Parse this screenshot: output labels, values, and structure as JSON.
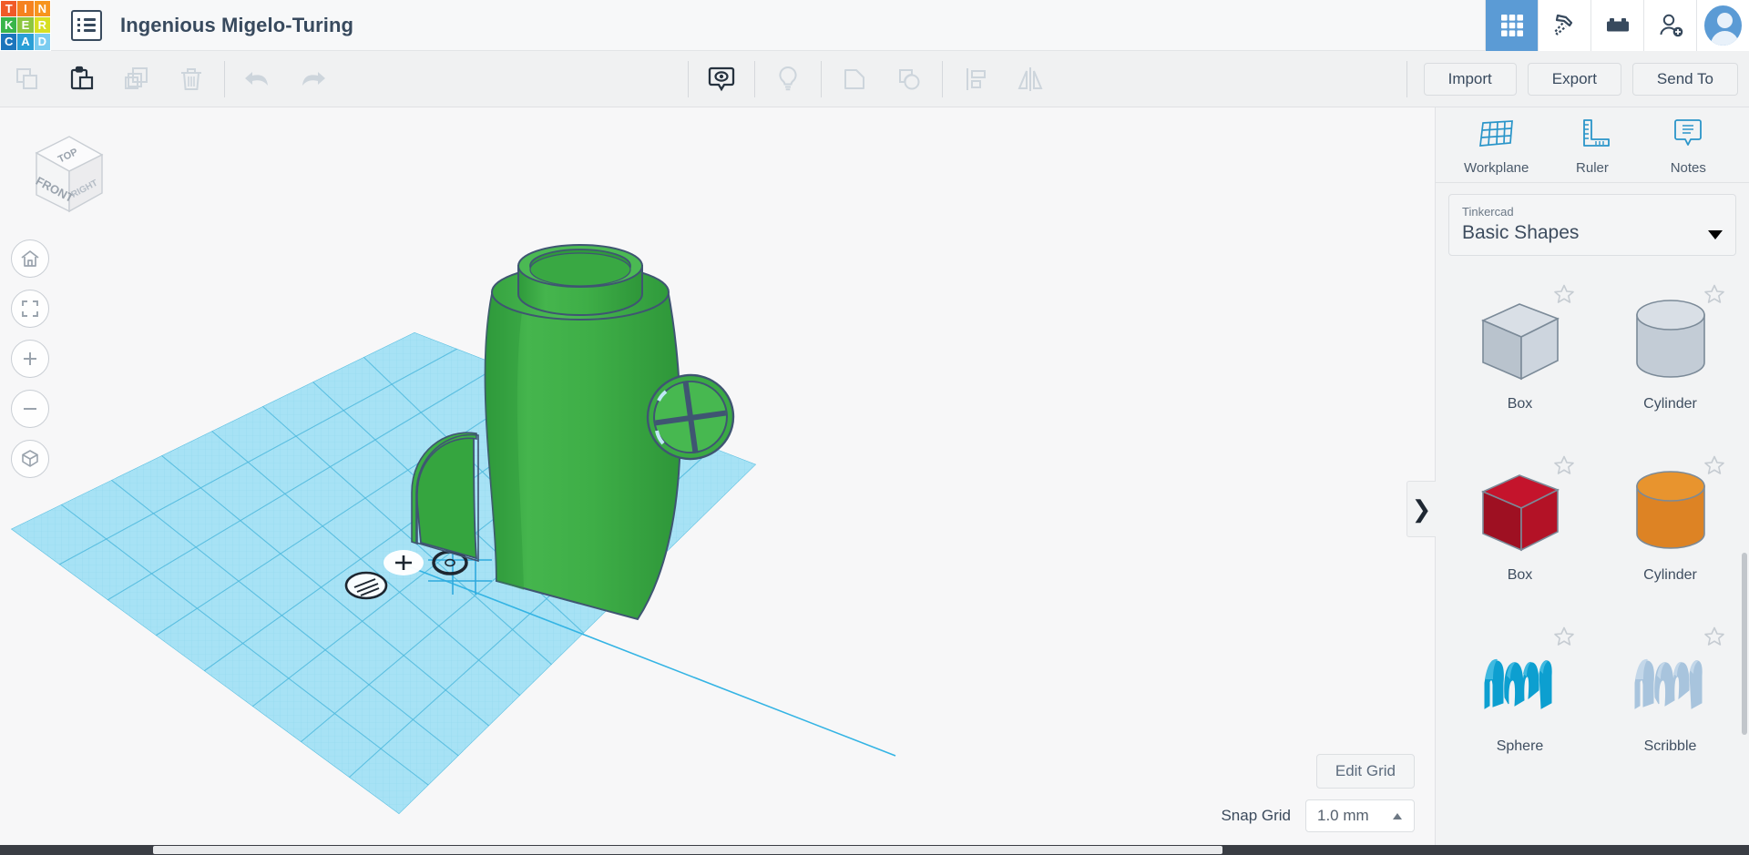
{
  "app": {
    "logo_letters": [
      {
        "ch": "T",
        "color": "#f05a28"
      },
      {
        "ch": "I",
        "color": "#f58220"
      },
      {
        "ch": "N",
        "color": "#f7941e"
      },
      {
        "ch": "K",
        "color": "#39b54a"
      },
      {
        "ch": "E",
        "color": "#8dc63f"
      },
      {
        "ch": "R",
        "color": "#d7df23"
      },
      {
        "ch": "C",
        "color": "#1b75bc"
      },
      {
        "ch": "A",
        "color": "#2a9fd6"
      },
      {
        "ch": "D",
        "color": "#7accf0"
      }
    ],
    "logo_name": "tinkercad-logo",
    "title": "Ingenious Migelo-Turing",
    "menu_icon": "list-menu-icon"
  },
  "top_right": {
    "items": [
      {
        "name": "grid-view-icon",
        "label": "Grid",
        "active": true
      },
      {
        "name": "pickaxe-icon",
        "label": "Minecraft",
        "active": false
      },
      {
        "name": "lego-brick-icon",
        "label": "Blocks",
        "active": false
      },
      {
        "name": "add-person-icon",
        "label": "Invite",
        "active": false
      }
    ],
    "avatar_label": "Account"
  },
  "toolbar": {
    "left_items": [
      {
        "name": "copy-icon",
        "label": "Copy",
        "enabled": false
      },
      {
        "name": "paste-icon",
        "label": "Paste",
        "enabled": true
      },
      {
        "name": "duplicate-icon",
        "label": "Duplicate",
        "enabled": false
      },
      {
        "name": "delete-icon",
        "label": "Delete",
        "enabled": false
      }
    ],
    "history_items": [
      {
        "name": "undo-icon",
        "label": "Undo",
        "enabled": false
      },
      {
        "name": "redo-icon",
        "label": "Redo",
        "enabled": false
      }
    ],
    "mid_items": [
      {
        "name": "show-hide-icon",
        "label": "Show/Hide",
        "enabled": true
      },
      {
        "name": "lightbulb-icon",
        "label": "Light",
        "enabled": false
      },
      {
        "name": "group-icon",
        "label": "Group",
        "enabled": false
      },
      {
        "name": "ungroup-icon",
        "label": "Ungroup",
        "enabled": false
      },
      {
        "name": "align-icon",
        "label": "Align",
        "enabled": false
      },
      {
        "name": "mirror-icon",
        "label": "Mirror",
        "enabled": false
      }
    ],
    "import_label": "Import",
    "export_label": "Export",
    "send_to_label": "Send To"
  },
  "viewport": {
    "viewcube": {
      "top": "TOP",
      "front": "FRONT",
      "right": "RIGHT"
    },
    "workplane_label": "Workplane",
    "nav_buttons": [
      {
        "name": "home-view-icon",
        "label": "Home view"
      },
      {
        "name": "fit-to-view-icon",
        "label": "Fit all in view"
      },
      {
        "name": "zoom-in-icon",
        "label": "Zoom in"
      },
      {
        "name": "zoom-out-icon",
        "label": "Zoom out"
      },
      {
        "name": "perspective-toggle-icon",
        "label": "Switch to orthographic view"
      }
    ],
    "model": {
      "name": "green-hut-model",
      "body_color": "#3caf46",
      "body_color_dark": "#2f9a3b",
      "body_color_light": "#56c05d",
      "outline_color": "#3f5572"
    },
    "workplane_markers": [
      {
        "name": "ruler-marker-icon"
      },
      {
        "name": "add-marker-icon"
      },
      {
        "name": "target-marker-icon"
      }
    ],
    "grid_color": "#8ed8f0",
    "grid_fill": "#a7e2f5"
  },
  "grid_controls": {
    "edit_grid_label": "Edit Grid",
    "snap_grid_label": "Snap Grid",
    "snap_grid_value": "1.0 mm"
  },
  "right_panel": {
    "tools": [
      {
        "name": "workplane-tool",
        "label": "Workplane",
        "icon": "workplane-icon"
      },
      {
        "name": "ruler-tool",
        "label": "Ruler",
        "icon": "ruler-icon"
      },
      {
        "name": "notes-tool",
        "label": "Notes",
        "icon": "notes-icon"
      }
    ],
    "library": {
      "group": "Tinkercad",
      "selected": "Basic Shapes"
    },
    "shapes": [
      {
        "label": "Box",
        "kind": "box-hole",
        "colors": {
          "top": "#d9dfe6",
          "left": "#b9c3cd",
          "right": "#cdd5de"
        }
      },
      {
        "label": "Cylinder",
        "kind": "cylinder-hole",
        "colors": {
          "top": "#d9dfe6",
          "body": "#c3ccd6"
        }
      },
      {
        "label": "Box",
        "kind": "box-solid",
        "colors": {
          "top": "#c4142c",
          "left": "#9e1022",
          "right": "#b31226"
        }
      },
      {
        "label": "Cylinder",
        "kind": "cylinder-solid",
        "colors": {
          "top": "#e8942e",
          "body": "#dd8324"
        }
      },
      {
        "label": "Sphere",
        "kind": "sphere",
        "colors": {
          "body": "#0d9fd0",
          "hi": "#3fb9e0"
        }
      },
      {
        "label": "Scribble",
        "kind": "scribble",
        "colors": {
          "body": "#a8c4dd",
          "hi": "#c3d7e9"
        }
      }
    ],
    "collapse_icon": "chevron-right-icon"
  },
  "colors": {
    "accent": "#5b9bd5",
    "panel_bg": "#f2f3f4",
    "text": "#394a5e"
  }
}
